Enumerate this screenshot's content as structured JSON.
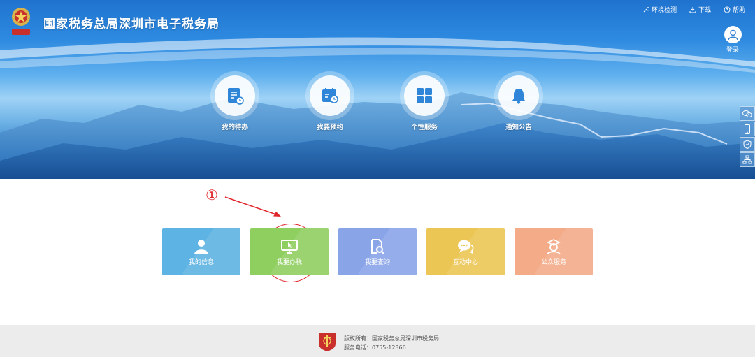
{
  "header": {
    "title": "国家税务总局深圳市电子税务局",
    "links": [
      {
        "label": "环境检测",
        "icon": "wrench-icon"
      },
      {
        "label": "下载",
        "icon": "download-icon"
      },
      {
        "label": "帮助",
        "icon": "help-icon"
      }
    ],
    "login_label": "登录"
  },
  "quick_links": [
    {
      "label": "我的待办",
      "icon": "todo-icon"
    },
    {
      "label": "我要预约",
      "icon": "calendar-icon"
    },
    {
      "label": "个性服务",
      "icon": "grid-icon"
    },
    {
      "label": "通知公告",
      "icon": "bell-icon"
    }
  ],
  "side_tools": [
    "wechat-icon",
    "mobile-icon",
    "shield-icon",
    "network-icon"
  ],
  "annotation": {
    "number": "①",
    "color": "#e0262a"
  },
  "tiles": [
    {
      "label": "我的信息",
      "icon": "user-icon",
      "color": "#5db3e3"
    },
    {
      "label": "我要办税",
      "icon": "monitor-icon",
      "color": "#8fcf5f"
    },
    {
      "label": "我要查询",
      "icon": "search-doc-icon",
      "color": "#8aa4e8"
    },
    {
      "label": "互动中心",
      "icon": "chat-icon",
      "color": "#ebc654"
    },
    {
      "label": "公众服务",
      "icon": "public-service-icon",
      "color": "#f3ab88"
    }
  ],
  "footer": {
    "copyright": "版权所有：国家税务总局深圳市税务局",
    "phone": "服务电话：0755-12366"
  }
}
